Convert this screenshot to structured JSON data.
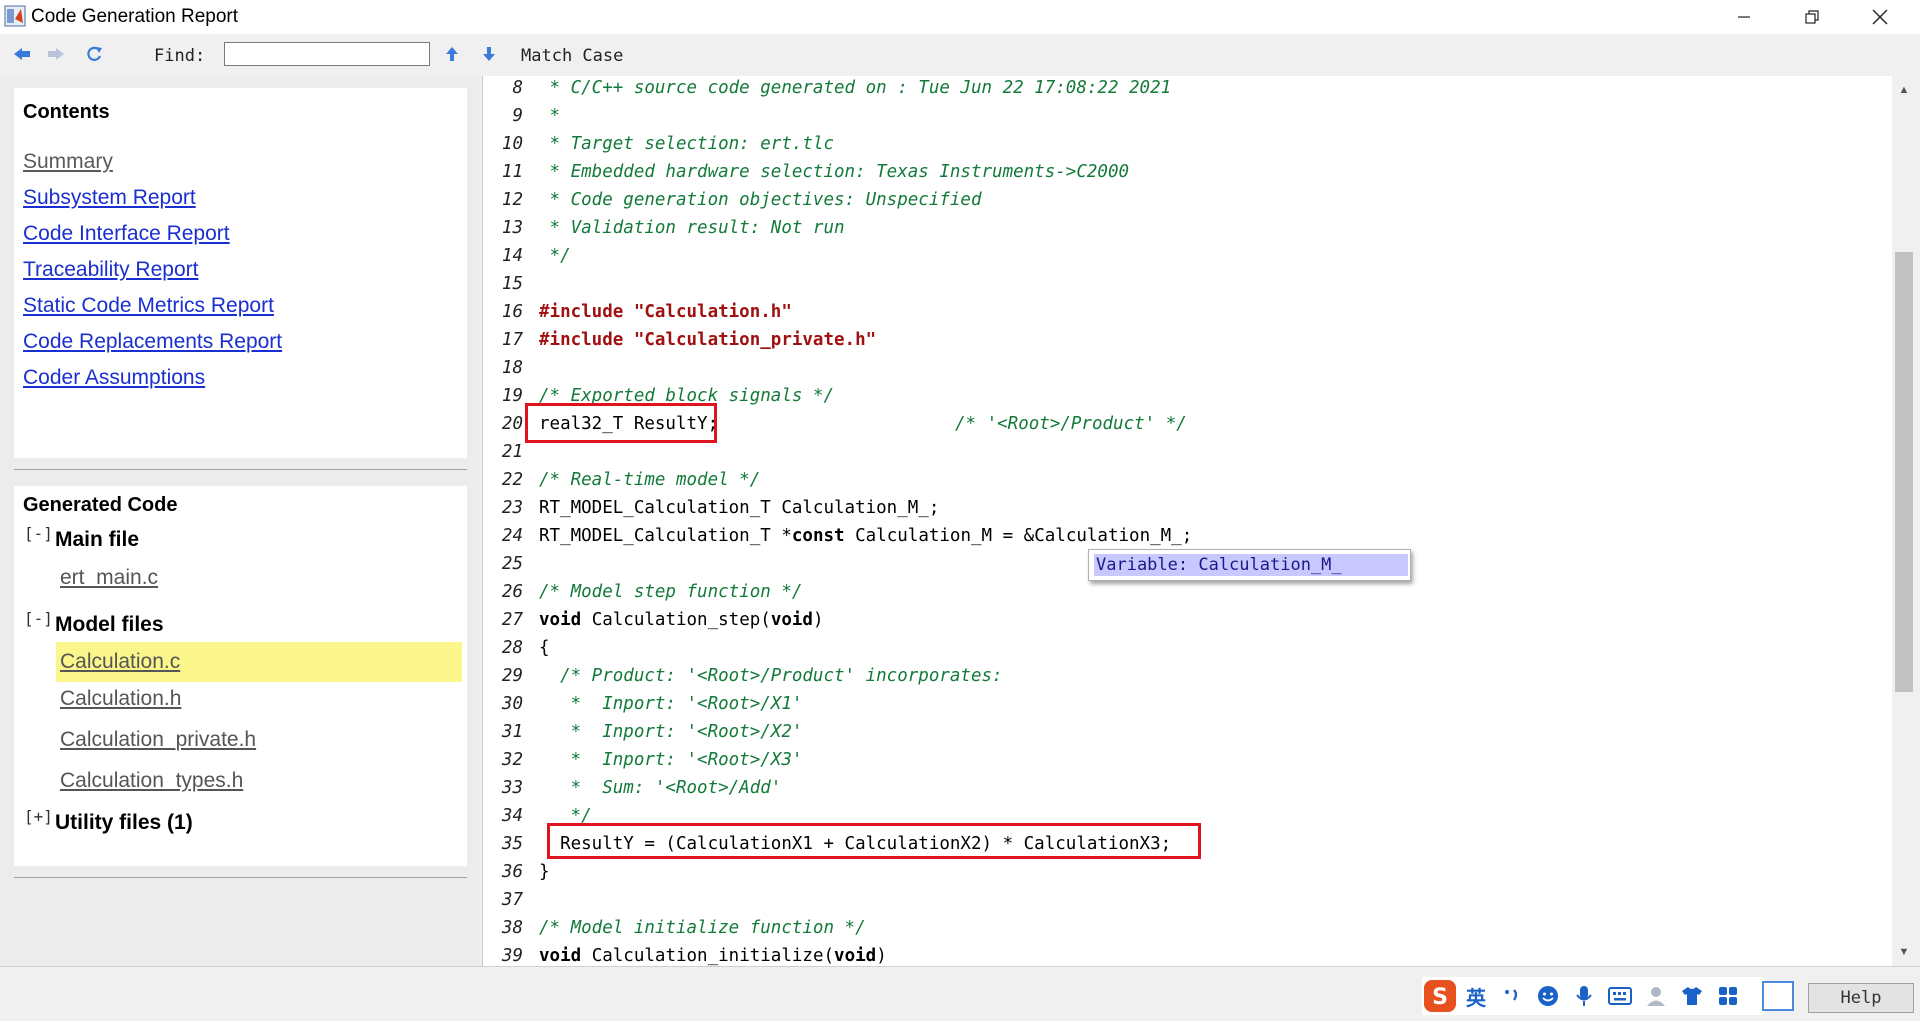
{
  "window": {
    "title": "Code Generation Report",
    "controls": [
      "minimize",
      "restore",
      "close"
    ]
  },
  "toolbar": {
    "find_label": "Find:",
    "find_value": "",
    "match_case_label": "Match Case"
  },
  "contents": {
    "title": "Contents",
    "links": [
      {
        "label": "Summary",
        "visited": true
      },
      {
        "label": "Subsystem Report",
        "visited": false
      },
      {
        "label": "Code Interface Report",
        "visited": false
      },
      {
        "label": "Traceability Report",
        "visited": false
      },
      {
        "label": "Static Code Metrics Report",
        "visited": false
      },
      {
        "label": "Code Replacements Report",
        "visited": false
      },
      {
        "label": "Coder Assumptions",
        "visited": false
      }
    ]
  },
  "generated_code": {
    "title": "Generated Code",
    "groups": [
      {
        "toggle": "[-]",
        "label": "Main file",
        "files": [
          "ert_main.c"
        ]
      },
      {
        "toggle": "[-]",
        "label": "Model files",
        "files": [
          "Calculation.c",
          "Calculation.h",
          "Calculation_private.h",
          "Calculation_types.h"
        ],
        "current": "Calculation.c"
      },
      {
        "toggle": "[+]",
        "label": "Utility files (1)",
        "files": []
      }
    ]
  },
  "code": {
    "lines": [
      {
        "n": "8",
        "text": " * C/C++ source code generated on : Tue Jun 22 17:08:22 2021"
      },
      {
        "n": "9",
        "text": " *"
      },
      {
        "n": "10",
        "text": " * Target selection: ert.tlc"
      },
      {
        "n": "11",
        "text": " * Embedded hardware selection: Texas Instruments->C2000"
      },
      {
        "n": "12",
        "text": " * Code generation objectives: Unspecified"
      },
      {
        "n": "13",
        "text": " * Validation result: Not run"
      },
      {
        "n": "14",
        "text": " */"
      },
      {
        "n": "15",
        "text": ""
      },
      {
        "n": "16",
        "text": "#include \"Calculation.h\""
      },
      {
        "n": "17",
        "text": "#include \"Calculation_private.h\""
      },
      {
        "n": "18",
        "text": ""
      },
      {
        "n": "19",
        "text": "/* Exported block signals */"
      },
      {
        "n": "20",
        "text": "real32_T ResultY;",
        "trail": "/* '<Root>/Product' */"
      },
      {
        "n": "21",
        "text": ""
      },
      {
        "n": "22",
        "text": "/* Real-time model */"
      },
      {
        "n": "23",
        "text": "RT_MODEL_Calculation_T Calculation_M_;"
      },
      {
        "n": "24",
        "text": "RT_MODEL_Calculation_T *const Calculation_M = &Calculation_M_;"
      },
      {
        "n": "25",
        "text": ""
      },
      {
        "n": "26",
        "text": "/* Model step function */"
      },
      {
        "n": "27",
        "text": "void Calculation_step(void)"
      },
      {
        "n": "28",
        "text": "{"
      },
      {
        "n": "29",
        "text": "  /* Product: '<Root>/Product' incorporates:"
      },
      {
        "n": "30",
        "text": "   *  Inport: '<Root>/X1'"
      },
      {
        "n": "31",
        "text": "   *  Inport: '<Root>/X2'"
      },
      {
        "n": "32",
        "text": "   *  Inport: '<Root>/X3'"
      },
      {
        "n": "33",
        "text": "   *  Sum: '<Root>/Add'"
      },
      {
        "n": "34",
        "text": "   */"
      },
      {
        "n": "35",
        "text": "  ResultY = (CalculationX1 + CalculationX2) * CalculationX3;"
      },
      {
        "n": "36",
        "text": "}"
      },
      {
        "n": "37",
        "text": ""
      },
      {
        "n": "38",
        "text": "/* Model initialize function */"
      },
      {
        "n": "39",
        "text": "void Calculation_initialize(void)"
      }
    ],
    "tooltip": "Variable: Calculation_M_"
  },
  "bottom": {
    "ime_label": "英",
    "help_label": "Help"
  }
}
